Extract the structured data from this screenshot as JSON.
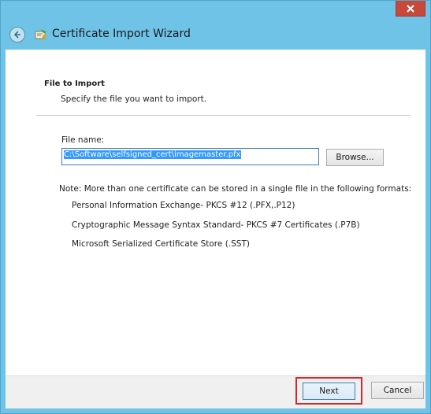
{
  "window": {
    "title": "Certificate Import Wizard",
    "close_icon": "close-icon",
    "back_icon": "back-arrow-icon",
    "app_icon": "certificate-icon",
    "accent_color": "#6fc3e6",
    "close_color": "#c7493a"
  },
  "section": {
    "title": "File to Import",
    "description": "Specify the file you want to import."
  },
  "file": {
    "label": "File name:",
    "value": "C:\\Software\\selfsigned_cert\\imagemaster.pfx",
    "browse_label": "Browse..."
  },
  "note": "Note:  More than one certificate can be stored in a single file in the following formats:",
  "formats": [
    "Personal Information Exchange- PKCS #12 (.PFX,.P12)",
    "Cryptographic Message Syntax Standard- PKCS #7 Certificates (.P7B)",
    "Microsoft Serialized Certificate Store (.SST)"
  ],
  "footer": {
    "next_label": "Next",
    "cancel_label": "Cancel",
    "highlight_color": "#d4282d"
  }
}
